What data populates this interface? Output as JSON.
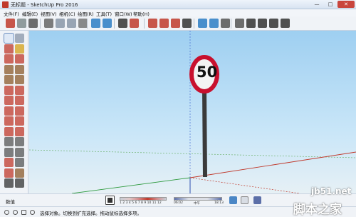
{
  "window": {
    "title": "无标题 - SketchUp Pro 2016",
    "minimize": "—",
    "maximize": "□",
    "close": "✕"
  },
  "menu": [
    {
      "label": "文件(F)"
    },
    {
      "label": "编辑(E)"
    },
    {
      "label": "视图(V)"
    },
    {
      "label": "相机(C)"
    },
    {
      "label": "绘图(R)"
    },
    {
      "label": "工具(T)"
    },
    {
      "label": "窗口(W)"
    },
    {
      "label": "帮助(H)"
    }
  ],
  "toolbar": {
    "buttons": [
      {
        "name": "open-model-icon",
        "color": "#c0392b"
      },
      {
        "name": "model-info-icon",
        "color": "#7f8c8d"
      },
      {
        "name": "print-icon",
        "color": "#555555"
      },
      {
        "name": "cut-icon",
        "color": "#666666"
      },
      {
        "name": "copy-icon",
        "color": "#8896a8"
      },
      {
        "name": "paste-icon",
        "color": "#8896a8"
      },
      {
        "name": "erase-icon",
        "color": "#777777"
      },
      {
        "name": "undo-icon",
        "color": "#2c7cc4"
      },
      {
        "name": "redo-icon",
        "color": "#2c7cc4"
      },
      {
        "name": "print-preview-icon",
        "color": "#333333"
      },
      {
        "name": "model-uploader-icon",
        "color": "#c0392b"
      },
      {
        "name": "3d-warehouse-icon",
        "color": "#c0392b"
      },
      {
        "name": "extension-warehouse-icon",
        "color": "#c0392b"
      },
      {
        "name": "share-component-icon",
        "color": "#c0392b"
      },
      {
        "name": "move-view-icon",
        "color": "#333333"
      },
      {
        "name": "layer-up-icon",
        "color": "#2c7cc4"
      },
      {
        "name": "layer-down-icon",
        "color": "#2c7cc4"
      },
      {
        "name": "iso-view-icon",
        "color": "#555555"
      },
      {
        "name": "top-view-icon",
        "color": "#555555"
      },
      {
        "name": "home-view-icon",
        "color": "#333333"
      },
      {
        "name": "front-view-icon",
        "color": "#333333"
      },
      {
        "name": "back-view-icon",
        "color": "#333333"
      },
      {
        "name": "left-view-icon",
        "color": "#333333"
      }
    ]
  },
  "left_tools": [
    {
      "name": "select-tool-icon",
      "color": "#222222",
      "selected": true
    },
    {
      "name": "make-component-icon",
      "color": "#8896a8"
    },
    {
      "name": "eraser-tool-icon",
      "color": "#c0392b"
    },
    {
      "name": "paint-bucket-icon",
      "color": "#d4a017"
    },
    {
      "name": "line-tool-icon",
      "color": "#c0392b"
    },
    {
      "name": "freehand-tool-icon",
      "color": "#c0392b"
    },
    {
      "name": "rectangle-tool-icon",
      "color": "#8b5a2b"
    },
    {
      "name": "rotated-rectangle-icon",
      "color": "#8b5a2b"
    },
    {
      "name": "circle-tool-icon",
      "color": "#8b5a2b"
    },
    {
      "name": "polygon-tool-icon",
      "color": "#8b5a2b"
    },
    {
      "name": "arc-tool-icon",
      "color": "#c0392b"
    },
    {
      "name": "two-point-arc-icon",
      "color": "#c0392b"
    },
    {
      "name": "three-point-arc-icon",
      "color": "#c0392b"
    },
    {
      "name": "pie-tool-icon",
      "color": "#c0392b"
    },
    {
      "name": "move-tool-icon",
      "color": "#c0392b"
    },
    {
      "name": "push-pull-icon",
      "color": "#c0392b"
    },
    {
      "name": "rotate-tool-icon",
      "color": "#c0392b"
    },
    {
      "name": "follow-me-icon",
      "color": "#c0392b"
    },
    {
      "name": "scale-tool-icon",
      "color": "#c0392b"
    },
    {
      "name": "offset-tool-icon",
      "color": "#c0392b"
    },
    {
      "name": "tape-measure-icon",
      "color": "#555555"
    },
    {
      "name": "dimension-tool-icon",
      "color": "#555555"
    },
    {
      "name": "protractor-tool-icon",
      "color": "#555555"
    },
    {
      "name": "text-tool-icon",
      "color": "#555555"
    },
    {
      "name": "axes-tool-icon",
      "color": "#c0392b"
    },
    {
      "name": "3d-text-icon",
      "color": "#555555"
    },
    {
      "name": "orbit-tool-icon",
      "color": "#c0392b"
    },
    {
      "name": "pan-tool-icon",
      "color": "#8b5a2b"
    },
    {
      "name": "zoom-tool-icon",
      "color": "#333333"
    },
    {
      "name": "zoom-window-icon",
      "color": "#333333"
    }
  ],
  "viewport": {
    "sign_text": "50",
    "sign_ring_color": "#c8102e",
    "sky_color": "#9ecff1"
  },
  "bottom_bar": {
    "measurements_label": "数值",
    "month_ticks": "1 2 3 4 5 6 7 8 9 10 11 12",
    "time_start": "06:02",
    "time_noon": "中午",
    "time_end": "18:13"
  },
  "status": {
    "text": "选择对象。切换到扩充选择。拖动鼠标选择多项。"
  },
  "watermark": {
    "url": "jb51.net",
    "site": "脚本之家"
  }
}
